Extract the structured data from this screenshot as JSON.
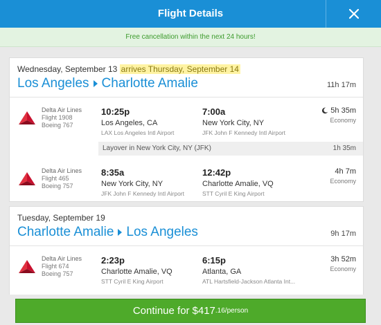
{
  "header": {
    "title": "Flight Details",
    "close_icon": "close-icon"
  },
  "banner": {
    "text": "Free cancellation within the next 24 hours!"
  },
  "trips": [
    {
      "date": "Wednesday, September 13",
      "arrives": "arrives Thursday, September 14",
      "origin": "Los Angeles",
      "destination": "Charlotte Amalie",
      "total_duration": "11h 17m",
      "segments": [
        {
          "airline": "Delta Air Lines",
          "flight": "Flight 1908",
          "aircraft": "Boeing 767",
          "dep_time": "10:25p",
          "dep_city": "Los Angeles, CA",
          "dep_airport": "LAX Los Angeles Intl Airport",
          "arr_time": "7:00a",
          "arr_city": "New York City, NY",
          "arr_airport": "JFK John F Kennedy Intl Airport",
          "duration": "5h 35m",
          "cabin": "Economy",
          "overnight": true
        },
        {
          "airline": "Delta Air Lines",
          "flight": "Flight 465",
          "aircraft": "Boeing 757",
          "dep_time": "8:35a",
          "dep_city": "New York City, NY",
          "dep_airport": "JFK John F Kennedy Intl Airport",
          "arr_time": "12:42p",
          "arr_city": "Charlotte Amalie, VQ",
          "arr_airport": "STT Cyril E King Airport",
          "duration": "4h 7m",
          "cabin": "Economy"
        }
      ],
      "layover": {
        "text": "Layover in New York City, NY (JFK)",
        "duration": "1h 35m"
      }
    },
    {
      "date": "Tuesday, September 19",
      "origin": "Charlotte Amalie",
      "destination": "Los Angeles",
      "total_duration": "9h 17m",
      "segments": [
        {
          "airline": "Delta Air Lines",
          "flight": "Flight 674",
          "aircraft": "Boeing 757",
          "dep_time": "2:23p",
          "dep_city": "Charlotte Amalie, VQ",
          "dep_airport": "STT Cyril E King Airport",
          "arr_time": "6:15p",
          "arr_city": "Atlanta, GA",
          "arr_airport": "ATL Hartsfield-Jackson Atlanta Int...",
          "duration": "3h 52m",
          "cabin": "Economy"
        }
      ]
    }
  ],
  "footer": {
    "label": "Continue for",
    "price": "$417",
    "cents": ".16/person"
  },
  "colors": {
    "header": "#1a8fd6",
    "banner_bg": "#e3f3e1",
    "banner_text": "#3b9a2b",
    "route": "#1a8fd6",
    "continue": "#4eaa2a",
    "delta_red": "#c8102e"
  }
}
